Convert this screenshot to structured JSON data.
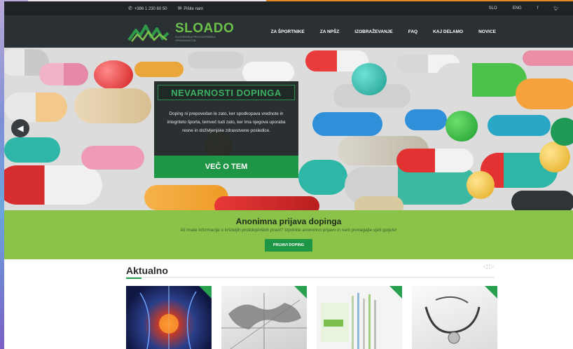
{
  "topbar": {
    "phone_icon": "phone-icon",
    "phone": "+386 1 230 60 50",
    "mail_icon": "envelope-icon",
    "mail_label": "Pišite nam",
    "lang_slo": "SLO",
    "lang_eng": "ENG",
    "facebook": "f",
    "twitter": "t"
  },
  "logo": {
    "brand": "SLOADO",
    "tagline": "SLOVENSKA PROTIDOPINŠKA ORGANIZACIJA"
  },
  "nav": {
    "items": [
      "ZA ŠPORTNIKE",
      "ZA NPŠZ",
      "IZOBRAŽEVANJE",
      "FAQ",
      "KAJ DELAMO",
      "NOVICE"
    ]
  },
  "hero": {
    "title": "NEVARNOSTI DOPINGA",
    "text": "Doping ni prepovedan le zato, ker spodkopava vrednote in integriteto športa, temveč tudi zato, ker ima njegova uporaba resne in doživljenjske zdravstvene posledice.",
    "cta": "VEČ O TEM",
    "prev_icon": "chevron-left-icon"
  },
  "band": {
    "heading": "Anonimna prijava dopinga",
    "text": "Ali imate informacije o kršiteljih protidopinških pravil? Izpolnite anonimno prijavo in nam pomagajte ujeti goljufe!",
    "button": "PRIJAVI DOPING"
  },
  "news": {
    "heading": "Aktualno",
    "pager": "◁ ▷"
  },
  "colors": {
    "accent_green": "#1f9546",
    "band_green": "#8bc34a",
    "dark_nav": "#2a3034"
  }
}
